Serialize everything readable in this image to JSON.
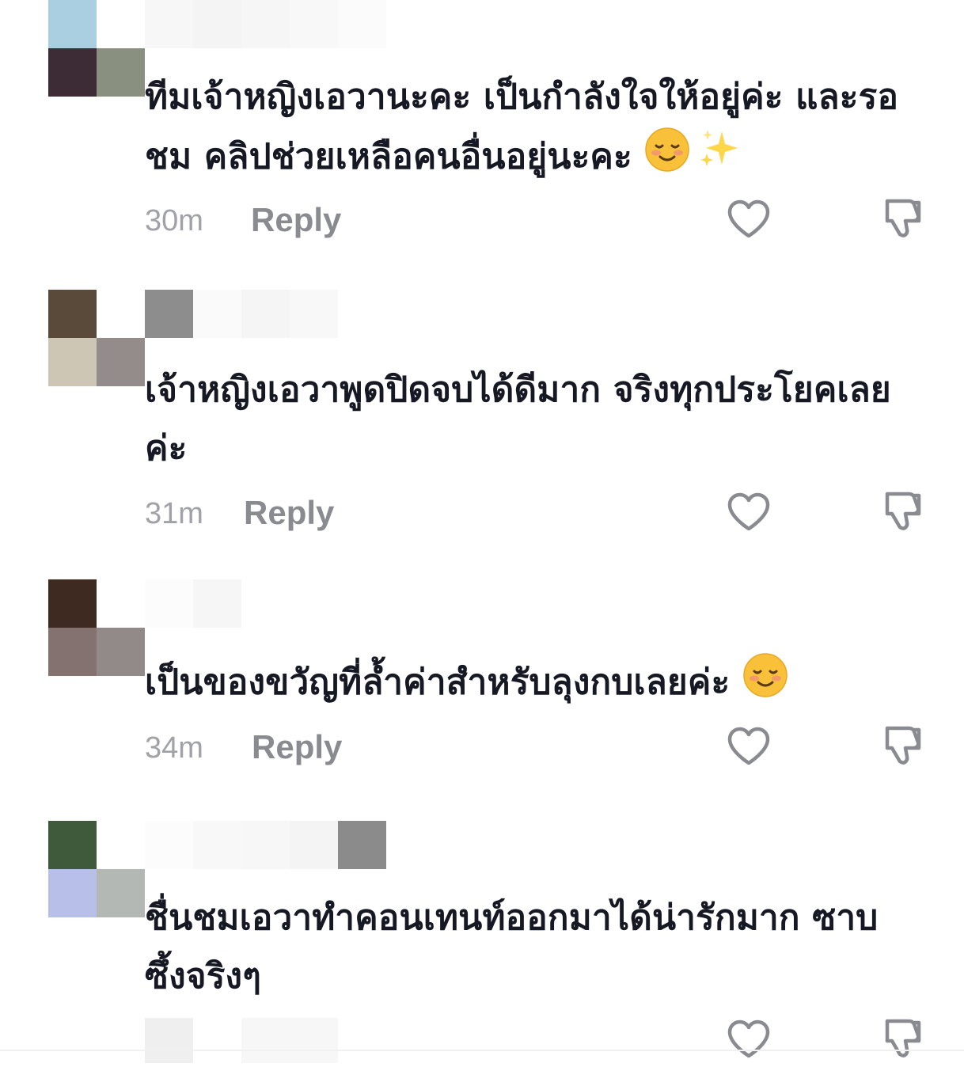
{
  "comments": [
    {
      "text_line1": "ทีมเจ้าหญิงเอวานะคะ เป็นกำลังใจให้อยู่ค่ะ และรอ",
      "text_line2": "ชม คลิปช่วยเหลือคนอื่นอยู่นะคะ",
      "emoji": [
        "smiling-face-emoji",
        "sparkles-emoji"
      ],
      "timestamp": "30m",
      "reply_label": "Reply"
    },
    {
      "text_line1": "เจ้าหญิงเอวาพูดปิดจบได้ดีมาก จริงทุกประโยคเลย",
      "text_line2": "ค่ะ",
      "timestamp": "31m",
      "reply_label": "Reply"
    },
    {
      "text_line1": "เป็นของขวัญที่ล้ำค่าสำหรับลุงกบเลยค่ะ",
      "emoji": [
        "smiling-face-emoji"
      ],
      "timestamp": "34m",
      "reply_label": "Reply"
    },
    {
      "text_line1": "ชื่นชมเอวาทำคอนเทนท์ออกมาได้น่ารักมาก ซาบ",
      "text_line2": "ซึ้งจริงๆ"
    }
  ],
  "icons": {
    "like": "heart-outline-icon",
    "dislike": "thumbs-down-outline-icon"
  },
  "colors": {
    "text": "#161823",
    "timestamp": "#a1a2a7",
    "reply": "#8a8b91",
    "icon": "#8a8b91"
  }
}
